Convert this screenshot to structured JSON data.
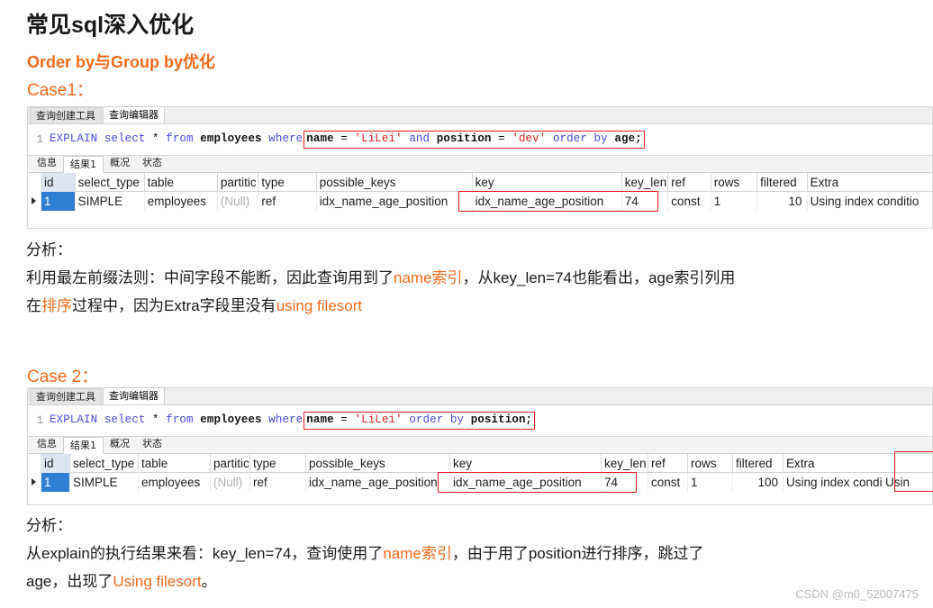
{
  "page": {
    "title": "常见sql深入优化",
    "subtitle": "Order by与Group by优化",
    "watermark": "CSDN @m0_52007475"
  },
  "case1": {
    "label": "Case1：",
    "editor_tabs": [
      {
        "label": "查询创建工具",
        "active": false
      },
      {
        "label": "查询编辑器",
        "active": true
      }
    ],
    "line_number": "1",
    "sql": {
      "prefix_parts": [
        {
          "text": "EXPLAIN",
          "kind": "kw"
        },
        {
          "text": " select ",
          "kind": "kw"
        },
        {
          "text": "* ",
          "kind": "op"
        },
        {
          "text": "from ",
          "kind": "kw"
        },
        {
          "text": "employees ",
          "kind": "ident"
        },
        {
          "text": "where",
          "kind": "kw"
        }
      ],
      "highlighted_parts": [
        {
          "text": "name ",
          "kind": "ident"
        },
        {
          "text": "= ",
          "kind": "op"
        },
        {
          "text": "'LiLei' ",
          "kind": "str"
        },
        {
          "text": "and ",
          "kind": "kw"
        },
        {
          "text": "position ",
          "kind": "ident"
        },
        {
          "text": "= ",
          "kind": "op"
        },
        {
          "text": "'dev' ",
          "kind": "str"
        },
        {
          "text": "order by ",
          "kind": "kw"
        },
        {
          "text": "age;",
          "kind": "ident"
        }
      ],
      "full_text": "EXPLAIN select * from employees where name = 'LiLei' and position = 'dev' order by age;"
    },
    "result_tabs": [
      {
        "label": "信息",
        "active": false
      },
      {
        "label": "结果1",
        "active": true
      },
      {
        "label": "概况",
        "active": false
      },
      {
        "label": "状态",
        "active": false
      }
    ],
    "grid": {
      "columns": [
        "id",
        "select_type",
        "table",
        "partitic",
        "type",
        "possible_keys",
        "key",
        "key_len",
        "ref",
        "rows",
        "filtered",
        "Extra"
      ],
      "rows": [
        {
          "id": "1",
          "select_type": "SIMPLE",
          "table": "employees",
          "partitions": "(Null)",
          "type": "ref",
          "possible_keys": "idx_name_age_position",
          "key": "idx_name_age_position",
          "key_len": "74",
          "ref": "const",
          "rows": "1",
          "filtered": "10",
          "extra": "Using index conditio"
        }
      ]
    },
    "analysis": {
      "heading": "分析：",
      "line1_a": "利用最左前缀法则：中间字段不能断，因此查询用到了",
      "line1_hl": "name索引",
      "line1_b": "，从key_len=74也能看出，age索引列用",
      "line2_a": "在",
      "line2_hl1": "排序",
      "line2_b": "过程中，因为Extra字段里没有",
      "line2_hl2": "using filesort"
    }
  },
  "case2": {
    "label": "Case 2：",
    "editor_tabs": [
      {
        "label": "查询创建工具",
        "active": false
      },
      {
        "label": "查询编辑器",
        "active": true
      }
    ],
    "line_number": "1",
    "sql": {
      "prefix_parts": [
        {
          "text": "EXPLAIN",
          "kind": "kw"
        },
        {
          "text": " select ",
          "kind": "kw"
        },
        {
          "text": "* ",
          "kind": "op"
        },
        {
          "text": "from ",
          "kind": "kw"
        },
        {
          "text": "employees ",
          "kind": "ident"
        },
        {
          "text": "where",
          "kind": "kw"
        }
      ],
      "highlighted_parts": [
        {
          "text": "name ",
          "kind": "ident"
        },
        {
          "text": "= ",
          "kind": "op"
        },
        {
          "text": "'LiLei' ",
          "kind": "str"
        },
        {
          "text": "order by ",
          "kind": "kw"
        },
        {
          "text": "position;",
          "kind": "ident"
        }
      ],
      "full_text": "EXPLAIN select * from employees where name = 'LiLei' order by position;"
    },
    "result_tabs": [
      {
        "label": "信息",
        "active": false
      },
      {
        "label": "结果1",
        "active": true
      },
      {
        "label": "概况",
        "active": false
      },
      {
        "label": "状态",
        "active": false
      }
    ],
    "grid": {
      "columns": [
        "id",
        "select_type",
        "table",
        "partitic",
        "type",
        "possible_keys",
        "key",
        "key_len",
        "ref",
        "rows",
        "filtered",
        "Extra"
      ],
      "rows": [
        {
          "id": "1",
          "select_type": "SIMPLE",
          "table": "employees",
          "partitions": "(Null)",
          "type": "ref",
          "possible_keys": "idx_name_age_position",
          "key": "idx_name_age_position",
          "key_len": "74",
          "ref": "const",
          "rows": "1",
          "filtered": "100",
          "extra": "Using index condition;",
          "extra_highlighted": "Usin"
        }
      ]
    },
    "analysis": {
      "heading": "分析：",
      "line1_a": "从explain的执行结果来看：key_len=74，查询使用了",
      "line1_hl": "name索引",
      "line1_b": "，由于用了position进行排序，跳过了",
      "line2_a": "age，出现了",
      "line2_hl": "Using filesort",
      "line2_b": "。"
    }
  }
}
